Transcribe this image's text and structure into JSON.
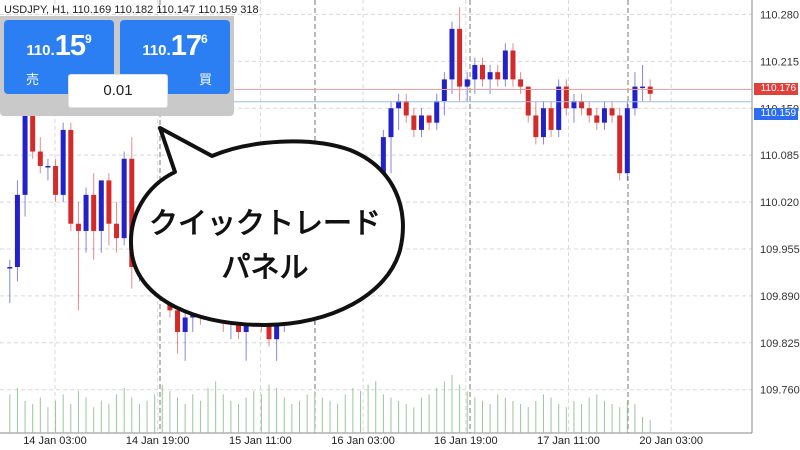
{
  "header": {
    "symbol_line": "USDJPY, H1, 110.169 110.182 110.147 110.159 318"
  },
  "trade_panel": {
    "sell": {
      "small": "110.",
      "big": "15",
      "sup": "9",
      "label": "売"
    },
    "buy": {
      "small": "110.",
      "big": "17",
      "sup": "6",
      "label": "買"
    },
    "lot": "0.01"
  },
  "callout": {
    "line1": "クイックトレード",
    "line2": "パネル"
  },
  "price_tags": {
    "ask": {
      "text": "110.176",
      "color": "#e0413a"
    },
    "bid": {
      "text": "110.159",
      "color": "#2c6cf0"
    }
  },
  "colors": {
    "bull": "#2222c8",
    "bear": "#d42a2a",
    "volume": "#9ac59a",
    "grid": "#d8d8d8",
    "sep": "#777777"
  },
  "chart_data": {
    "type": "candlestick",
    "symbol": "USDJPY",
    "timeframe": "H1",
    "ylim": [
      109.7,
      110.3
    ],
    "y_ticks": [
      110.28,
      110.215,
      110.15,
      110.085,
      110.02,
      109.955,
      109.89,
      109.825,
      109.76
    ],
    "x_labels": [
      "14 Jan 03:00",
      "14 Jan 19:00",
      "15 Jan 11:00",
      "16 Jan 03:00",
      "16 Jan 19:00",
      "17 Jan 11:00",
      "20 Jan 03:00"
    ],
    "ask": 110.176,
    "bid": 110.159,
    "candles": [
      [
        109.93,
        109.94,
        109.88,
        109.93
      ],
      [
        109.93,
        110.05,
        109.91,
        110.03
      ],
      [
        110.03,
        110.17,
        110.0,
        110.16
      ],
      [
        110.16,
        110.19,
        110.08,
        110.09
      ],
      [
        110.09,
        110.11,
        110.06,
        110.07
      ],
      [
        110.07,
        110.08,
        110.05,
        110.07
      ],
      [
        110.07,
        110.08,
        110.02,
        110.03
      ],
      [
        110.03,
        110.13,
        110.02,
        110.12
      ],
      [
        110.12,
        110.13,
        109.98,
        109.99
      ],
      [
        109.99,
        110.02,
        109.87,
        109.98
      ],
      [
        109.98,
        110.04,
        109.95,
        110.03
      ],
      [
        110.03,
        110.06,
        109.94,
        109.98
      ],
      [
        109.98,
        110.05,
        109.95,
        110.05
      ],
      [
        110.05,
        110.06,
        109.96,
        109.99
      ],
      [
        109.99,
        110.02,
        109.95,
        109.97
      ],
      [
        109.97,
        110.09,
        109.96,
        110.08
      ],
      [
        110.08,
        110.11,
        109.9,
        109.93
      ],
      [
        109.93,
        109.97,
        109.91,
        109.96
      ],
      [
        109.96,
        110.0,
        109.92,
        109.97
      ],
      [
        109.97,
        110.02,
        109.95,
        110.0
      ],
      [
        110.0,
        110.05,
        109.96,
        109.99
      ],
      [
        109.99,
        110.01,
        109.86,
        109.87
      ],
      [
        109.87,
        109.9,
        109.81,
        109.84
      ],
      [
        109.84,
        109.87,
        109.8,
        109.86
      ],
      [
        109.86,
        109.91,
        109.84,
        109.89
      ],
      [
        109.89,
        109.92,
        109.85,
        109.87
      ],
      [
        109.87,
        109.93,
        109.86,
        109.91
      ],
      [
        109.91,
        109.94,
        109.87,
        109.88
      ],
      [
        109.88,
        109.91,
        109.84,
        109.86
      ],
      [
        109.86,
        109.89,
        109.83,
        109.87
      ],
      [
        109.87,
        109.9,
        109.83,
        109.84
      ],
      [
        109.84,
        109.88,
        109.8,
        109.86
      ],
      [
        109.86,
        109.92,
        109.85,
        109.9
      ],
      [
        109.9,
        109.93,
        109.84,
        109.85
      ],
      [
        109.85,
        109.89,
        109.82,
        109.83
      ],
      [
        109.83,
        109.88,
        109.8,
        109.86
      ],
      [
        109.86,
        109.91,
        109.84,
        109.89
      ],
      [
        109.89,
        109.94,
        109.87,
        109.92
      ],
      [
        109.92,
        109.95,
        109.88,
        109.9
      ],
      [
        109.9,
        109.93,
        109.86,
        109.88
      ],
      [
        109.88,
        109.92,
        109.85,
        109.91
      ],
      [
        109.91,
        109.95,
        109.89,
        109.93
      ],
      [
        109.93,
        109.96,
        109.9,
        109.91
      ],
      [
        109.91,
        109.94,
        109.88,
        109.92
      ],
      [
        109.92,
        109.97,
        109.9,
        109.95
      ],
      [
        109.95,
        109.99,
        109.92,
        109.97
      ],
      [
        109.97,
        110.02,
        109.95,
        110.0
      ],
      [
        109.99,
        110.04,
        109.95,
        110.01
      ],
      [
        110.01,
        110.07,
        109.98,
        110.06
      ],
      [
        110.06,
        110.12,
        110.03,
        110.11
      ],
      [
        110.11,
        110.16,
        110.06,
        110.15
      ],
      [
        110.15,
        110.17,
        110.12,
        110.16
      ],
      [
        110.16,
        110.17,
        110.13,
        110.14
      ],
      [
        110.14,
        110.15,
        110.11,
        110.12
      ],
      [
        110.12,
        110.15,
        110.11,
        110.14
      ],
      [
        110.14,
        110.14,
        110.12,
        110.13
      ],
      [
        110.13,
        110.17,
        110.12,
        110.16
      ],
      [
        110.16,
        110.2,
        110.14,
        110.19
      ],
      [
        110.19,
        110.27,
        110.17,
        110.26
      ],
      [
        110.26,
        110.29,
        110.16,
        110.18
      ],
      [
        110.18,
        110.2,
        110.16,
        110.19
      ],
      [
        110.19,
        110.22,
        110.17,
        110.21
      ],
      [
        110.21,
        110.22,
        110.18,
        110.19
      ],
      [
        110.19,
        110.21,
        110.17,
        110.2
      ],
      [
        110.2,
        110.21,
        110.18,
        110.19
      ],
      [
        110.19,
        110.24,
        110.18,
        110.23
      ],
      [
        110.23,
        110.24,
        110.18,
        110.19
      ],
      [
        110.19,
        110.2,
        110.17,
        110.18
      ],
      [
        110.18,
        110.18,
        110.13,
        110.14
      ],
      [
        110.14,
        110.16,
        110.1,
        110.11
      ],
      [
        110.11,
        110.16,
        110.1,
        110.15
      ],
      [
        110.15,
        110.16,
        110.11,
        110.12
      ],
      [
        110.12,
        110.19,
        110.11,
        110.18
      ],
      [
        110.18,
        110.19,
        110.14,
        110.15
      ],
      [
        110.15,
        110.17,
        110.13,
        110.16
      ],
      [
        110.16,
        110.17,
        110.14,
        110.15
      ],
      [
        110.15,
        110.16,
        110.13,
        110.14
      ],
      [
        110.14,
        110.15,
        110.12,
        110.13
      ],
      [
        110.13,
        110.16,
        110.12,
        110.15
      ],
      [
        110.15,
        110.16,
        110.13,
        110.14
      ],
      [
        110.14,
        110.15,
        110.05,
        110.06
      ],
      [
        110.06,
        110.16,
        110.05,
        110.15
      ],
      [
        110.15,
        110.2,
        110.14,
        110.18
      ],
      [
        110.18,
        110.21,
        110.16,
        110.18
      ],
      [
        110.18,
        110.19,
        110.16,
        110.17
      ]
    ],
    "volume": [
      12,
      14,
      10,
      9,
      11,
      8,
      10,
      12,
      9,
      13,
      11,
      8,
      10,
      9,
      12,
      14,
      11,
      9,
      10,
      12,
      15,
      13,
      11,
      9,
      12,
      10,
      14,
      16,
      12,
      10,
      9,
      11,
      13,
      12,
      15,
      14,
      11,
      9,
      10,
      12,
      13,
      11,
      10,
      9,
      12,
      14,
      13,
      15,
      16,
      12,
      11,
      10,
      9,
      8,
      11,
      12,
      14,
      16,
      18,
      15,
      13,
      11,
      10,
      9,
      12,
      11,
      10,
      9,
      8,
      10,
      12,
      11,
      9,
      8,
      10,
      9,
      11,
      12,
      10,
      9,
      8,
      10,
      9,
      5,
      4
    ]
  }
}
